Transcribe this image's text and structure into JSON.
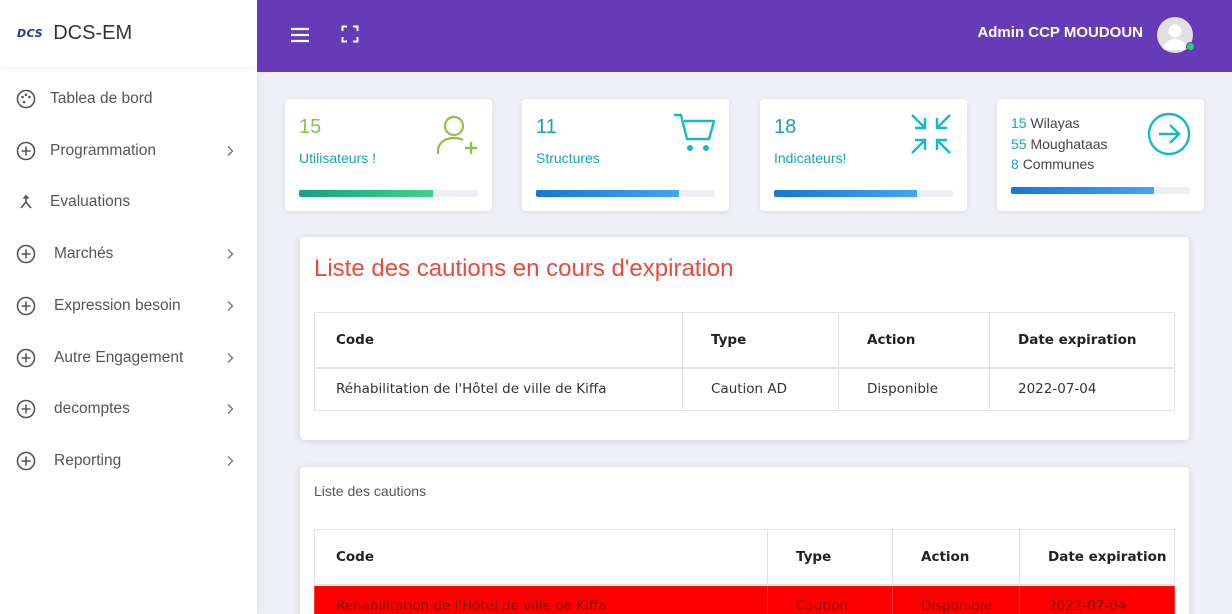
{
  "brand": {
    "logo": "DCS",
    "name": "DCS-EM"
  },
  "sidebar": {
    "items": [
      {
        "label": "Tablea de bord",
        "icon": "palette-icon",
        "has_chevron": false
      },
      {
        "label": "Programmation",
        "icon": "plus-circle-icon",
        "has_chevron": true
      },
      {
        "label": "Evaluations",
        "icon": "merge-icon",
        "has_chevron": false
      },
      {
        "label": "Marchés",
        "icon": "plus-circle-icon",
        "has_chevron": true
      },
      {
        "label": "Expression besoin",
        "icon": "plus-circle-icon",
        "has_chevron": true
      },
      {
        "label": "Autre Engagement",
        "icon": "plus-circle-icon",
        "has_chevron": true
      },
      {
        "label": "decomptes",
        "icon": "plus-circle-icon",
        "has_chevron": true
      },
      {
        "label": "Reporting",
        "icon": "plus-circle-icon",
        "has_chevron": true
      }
    ]
  },
  "header": {
    "username": "Admin CCP MOUDOUN",
    "menu_icon": "hamburger-icon",
    "fullscreen_icon": "fullscreen-icon",
    "avatar_icon": "user-avatar-icon",
    "header_color": "#673ab7"
  },
  "stats": {
    "users": {
      "value": "15",
      "label": "Utilisateurs !",
      "progress": 0.75,
      "color": "#8bc34a",
      "icon": "add-user-icon"
    },
    "structures": {
      "value": "11",
      "label": "Structures",
      "progress": 0.8,
      "color": "#1e88e5",
      "icon": "cart-icon"
    },
    "indicators": {
      "value": "18",
      "label": "Indicateurs!",
      "progress": 0.8,
      "color": "#1e88e5",
      "icon": "compress-arrows-icon"
    },
    "geo": {
      "wilayas_n": "15",
      "wilayas_label": "Wilayas",
      "moughataas_n": "55",
      "moughataas_label": "Moughataas",
      "communes_n": "8",
      "communes_label": "Communes",
      "progress": 0.8,
      "icon": "arrow-circle-right-icon"
    }
  },
  "expiring": {
    "title": "Liste des cautions en cours d'expiration",
    "columns": [
      "Code",
      "Type",
      "Action",
      "Date expiration"
    ],
    "rows": [
      [
        "Réhabilitation de l'Hôtel de ville de Kiffa",
        "Caution AD",
        "Disponible",
        "2022-07-04"
      ]
    ]
  },
  "all_cautions": {
    "title": "Liste des cautions",
    "columns": [
      "Code",
      "Type",
      "Action",
      "Date expiration"
    ],
    "rows": [
      [
        "Réhabilitation de l'Hôtel de ville de Kiffa",
        "Caution",
        "Disponible",
        "2022-07-04"
      ]
    ],
    "highlight_color": "#ff0000"
  }
}
